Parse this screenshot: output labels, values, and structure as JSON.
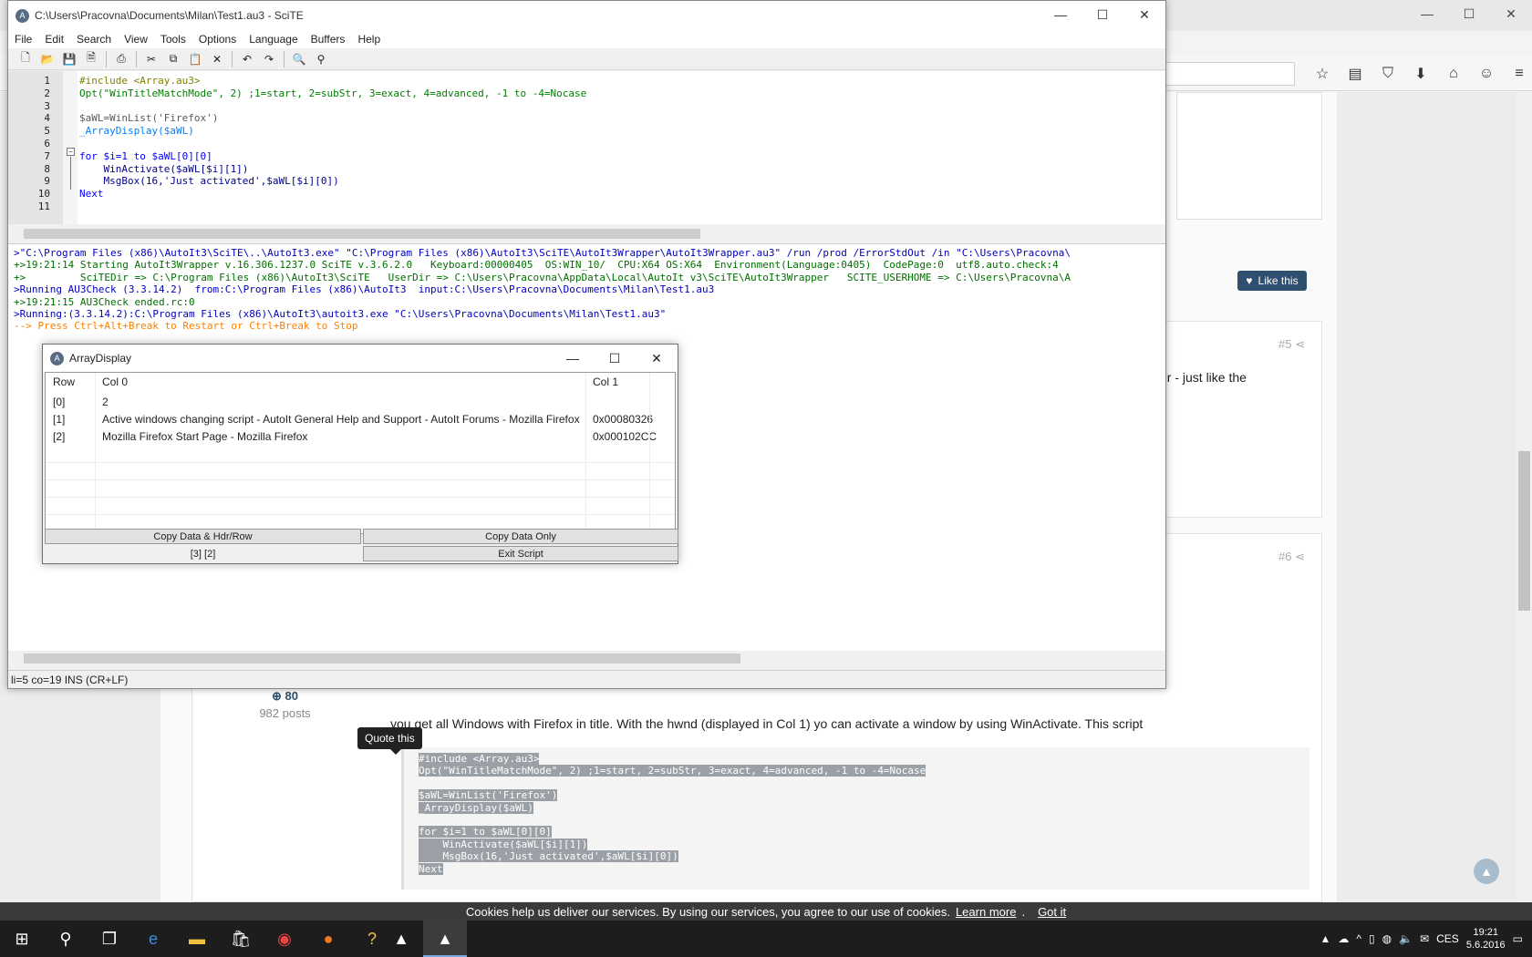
{
  "firefox": {
    "window_controls": [
      "—",
      "☐",
      "✕"
    ],
    "toolbar_icons": [
      "☆",
      "▤",
      "⛉",
      "⬇",
      "⌂",
      "☺",
      "≡"
    ],
    "like_label": "Like this",
    "post5_number": "#5",
    "post6_number": "#6",
    "post5_snippet": "er - just like the",
    "author_rep": "80",
    "author_posts": "982 posts",
    "post6_text": "you get all Windows with Firefox in title. With the hwnd (displayed in Col 1) yo can activate a window by using WinActivate. This script",
    "quote_tooltip": "Quote this",
    "code_lines": [
      "#include <Array.au3>",
      "Opt(\"WinTitleMatchMode\", 2) ;1=start, 2=subStr, 3=exact, 4=advanced, -1 to -4=Nocase",
      "",
      "$aWL=WinList('Firefox')",
      "_ArrayDisplay($aWL)",
      "",
      "for $i=1 to $aWL[0][0]",
      "    WinActivate($aWL[$i][1])",
      "    MsgBox(16,'Just activated',$aWL[$i][0])",
      "Next"
    ],
    "cookie_text": "Cookies help us deliver our services. By using our services, you agree to our use of cookies.",
    "cookie_learn": "Learn more",
    "cookie_sep": ".",
    "cookie_got": "Got it"
  },
  "scite": {
    "title": "C:\\Users\\Pracovna\\Documents\\Milan\\Test1.au3 - SciTE",
    "menu": [
      "File",
      "Edit",
      "Search",
      "View",
      "Tools",
      "Options",
      "Language",
      "Buffers",
      "Help"
    ],
    "line_numbers": [
      "1",
      "2",
      "3",
      "4",
      "5",
      "6",
      "7",
      "8",
      "9",
      "10",
      "11"
    ],
    "output_lines": [
      {
        ">": ">\"C:\\Program Files (x86)\\AutoIt3\\SciTE\\..\\AutoIt3.exe\" \"C:\\Program Files (x86)\\AutoIt3\\SciTE\\AutoIt3Wrapper\\AutoIt3Wrapper.au3\" /run /prod /ErrorStdOut /in \"C:\\Users\\Pracovna\\",
        "c": "blue"
      },
      {
        ">": "+>19:21:14 Starting AutoIt3Wrapper v.16.306.1237.0 SciTE v.3.6.2.0   Keyboard:00000405  OS:WIN_10/  CPU:X64 OS:X64  Environment(Language:0405)  CodePage:0  utf8.auto.check:4",
        "c": "green"
      },
      {
        ">": "+>         SciTEDir => C:\\Program Files (x86)\\AutoIt3\\SciTE   UserDir => C:\\Users\\Pracovna\\AppData\\Local\\AutoIt v3\\SciTE\\AutoIt3Wrapper   SCITE_USERHOME => C:\\Users\\Pracovna\\A",
        "c": "green"
      },
      {
        ">": ">Running AU3Check (3.3.14.2)  from:C:\\Program Files (x86)\\AutoIt3  input:C:\\Users\\Pracovna\\Documents\\Milan\\Test1.au3",
        "c": "blue"
      },
      {
        ">": "+>19:21:15 AU3Check ended.rc:0",
        "c": "green"
      },
      {
        ">": ">Running:(3.3.14.2):C:\\Program Files (x86)\\AutoIt3\\autoit3.exe \"C:\\Users\\Pracovna\\Documents\\Milan\\Test1.au3\"",
        "c": "blue"
      },
      {
        ">": "--> Press Ctrl+Alt+Break to Restart or Ctrl+Break to Stop",
        "c": "orange"
      }
    ],
    "status": "li=5 co=19 INS (CR+LF)"
  },
  "array_display": {
    "title": "ArrayDisplay",
    "headers": [
      "Row",
      "Col 0",
      "Col 1"
    ],
    "rows": [
      [
        "[0]",
        "2",
        ""
      ],
      [
        "[1]",
        "Active windows changing script - AutoIt General Help and Support - AutoIt Forums - Mozilla Firefox",
        "0x00080326"
      ],
      [
        "[2]",
        "Mozilla Firefox Start Page - Mozilla Firefox",
        "0x000102CC"
      ]
    ],
    "btn_copy_hdr": "Copy Data & Hdr/Row",
    "btn_copy_data": "Copy Data Only",
    "dims": "[3] [2]",
    "btn_exit": "Exit Script"
  },
  "taskbar": {
    "lang": "CES",
    "time": "19:21",
    "date": "5.6.2016"
  }
}
